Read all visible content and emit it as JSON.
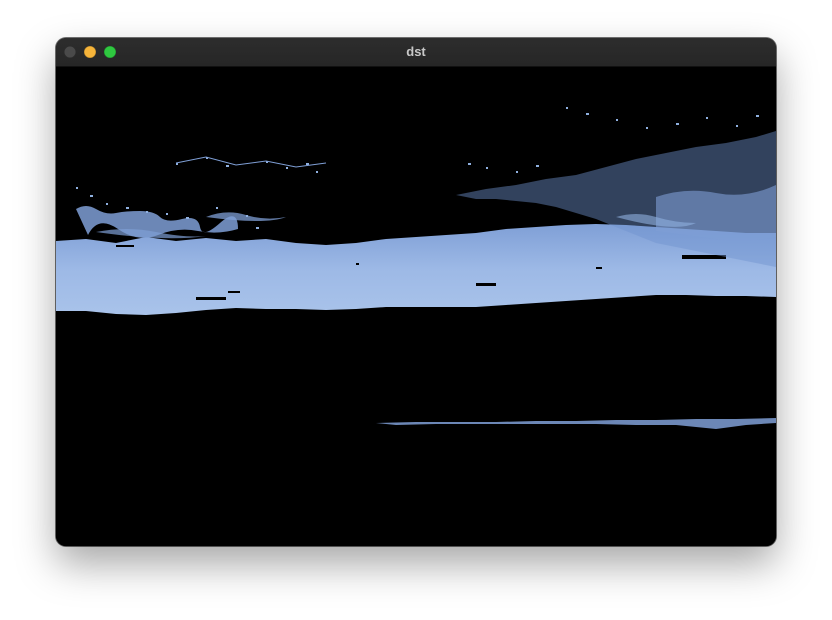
{
  "window": {
    "title": "dst",
    "buttons": [
      "close",
      "minimize",
      "zoom"
    ]
  },
  "image": {
    "description_colors": {
      "background": "#000000",
      "sky_light": "#a9c3ea",
      "sky_mid": "#8fb0e0",
      "sky_dark": "#6f93cf"
    }
  }
}
